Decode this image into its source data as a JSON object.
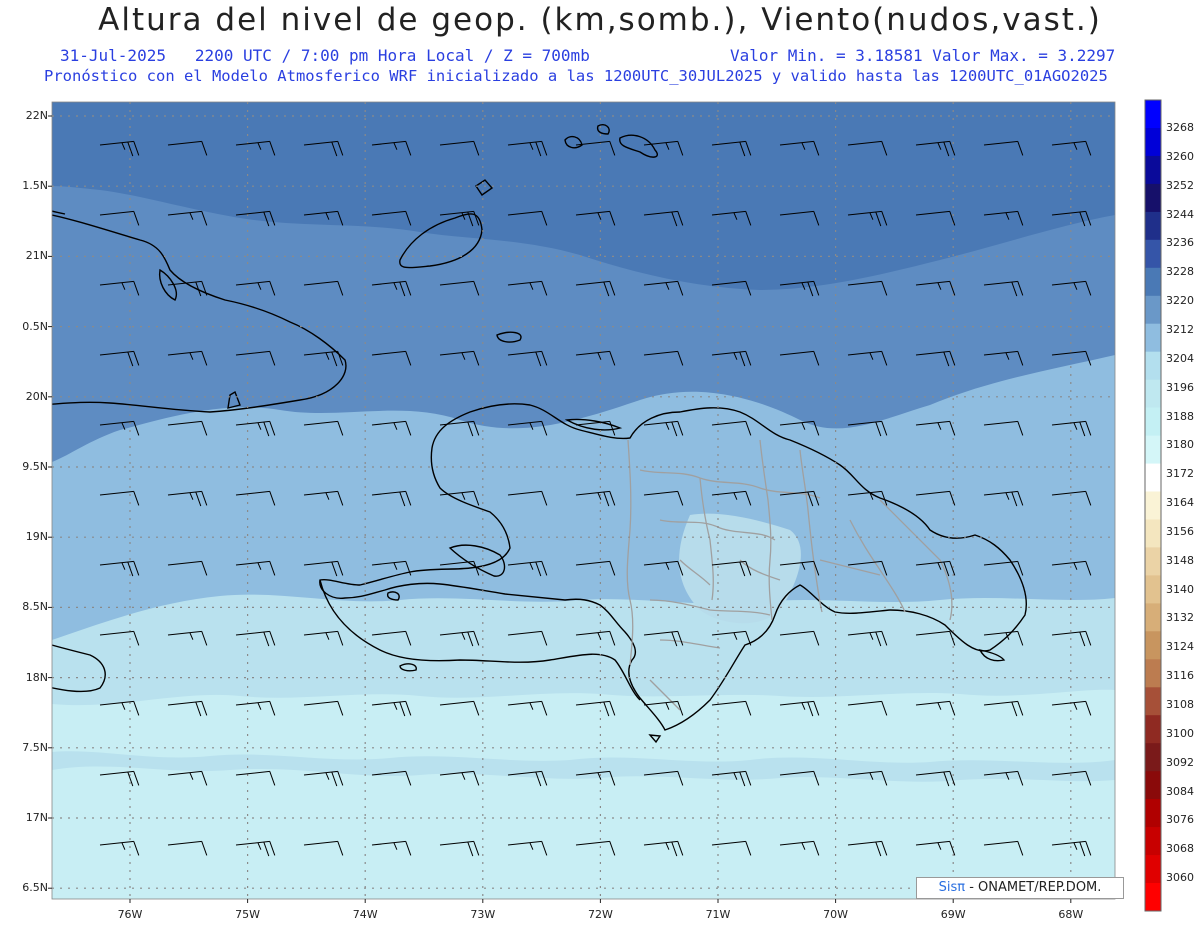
{
  "header": {
    "title": "Altura del nivel de geop. (km,somb.), Viento(nudos,vast.)",
    "date": "31-Jul-2025",
    "time": "2200 UTC / 7:00 pm Hora Local / Z = 700mb",
    "min_max": "Valor Min. = 3.18581  Valor Max. = 3.2297",
    "model_info": "Pronóstico con el Modelo Atmosferico WRF inicializado a las 1200UTC_30JUL2025 y valido hasta las  1200UTC_01AGO2025"
  },
  "map": {
    "lat_labels": [
      "22N",
      "1.5N",
      "21N",
      "0.5N",
      "20N",
      "9.5N",
      "19N",
      "8.5N",
      "18N",
      "7.5N",
      "17N",
      "6.5N"
    ],
    "lon_labels": [
      "76W",
      "75W",
      "74W",
      "73W",
      "72W",
      "71W",
      "70W",
      "69W",
      "68W"
    ],
    "fill_colors": {
      "band_3228": "#4a79b5",
      "band_3220": "#5e8cc2",
      "band_3212": "#8fbde0",
      "band_3204": "#b9e1ee",
      "band_3196": "#c8eef4"
    },
    "coast_color": "#000000",
    "border_color": "#a0a0a0"
  },
  "colorbar": {
    "labels": [
      "3268",
      "3260",
      "3252",
      "3244",
      "3236",
      "3228",
      "3220",
      "3212",
      "3204",
      "3196",
      "3188",
      "3180",
      "3172",
      "3164",
      "3156",
      "3148",
      "3140",
      "3132",
      "3124",
      "3116",
      "3108",
      "3100",
      "3092",
      "3084",
      "3076",
      "3068",
      "3060"
    ],
    "colors": [
      "#ff0000",
      "#e00000",
      "#c80000",
      "#b00000",
      "#8a0a0a",
      "#7a1a1a",
      "#8f2a22",
      "#a65038",
      "#bc7c50",
      "#c8955f",
      "#d7ae78",
      "#e2c28f",
      "#ebd3a6",
      "#f4e6bf",
      "#faf3d6",
      "#ffffff",
      "#d4f6f8",
      "#c4f0f4",
      "#bfe8f0",
      "#b3dfee",
      "#8fbde0",
      "#6a98c8",
      "#4a79b5",
      "#3555a8",
      "#1f2f8a",
      "#16106a",
      "#0a0a9a",
      "#0000d8",
      "#0000ff"
    ]
  },
  "credit": {
    "brand": "Sisπ",
    "text": "- ONAMET/REP.DOM."
  }
}
